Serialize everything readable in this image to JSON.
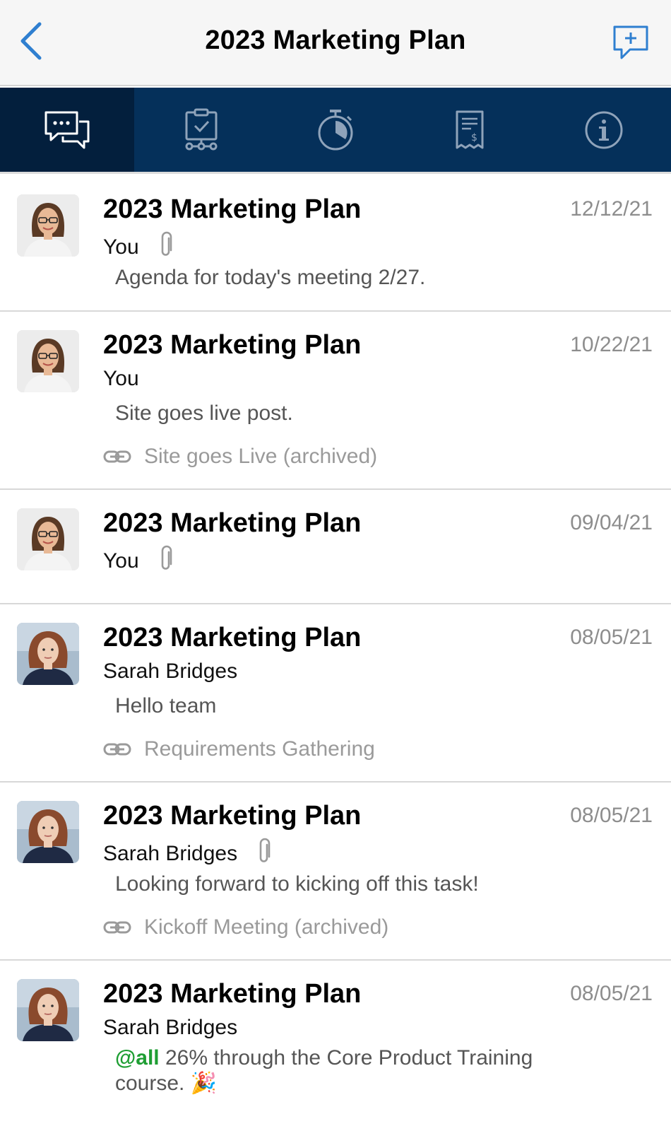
{
  "header": {
    "title": "2023 Marketing Plan",
    "back_icon": "chevron-left-icon",
    "new_comment_icon": "add-comment-icon",
    "accent_color": "#2f7fd0"
  },
  "tabs": [
    {
      "icon": "comments-icon",
      "active": true
    },
    {
      "icon": "task-board-icon",
      "active": false
    },
    {
      "icon": "timer-icon",
      "active": false
    },
    {
      "icon": "receipt-icon",
      "active": false
    },
    {
      "icon": "info-icon",
      "active": false
    }
  ],
  "tabbar_color": "#05305a",
  "messages": [
    {
      "title": "2023 Marketing Plan",
      "author": "You",
      "date": "12/12/21",
      "has_attachment": true,
      "message": "Agenda for today's meeting 2/27.",
      "link": null
    },
    {
      "title": "2023 Marketing Plan",
      "author": "You",
      "date": "10/22/21",
      "has_attachment": false,
      "message": "Site goes live post.",
      "link": "Site goes Live (archived)"
    },
    {
      "title": "2023 Marketing Plan",
      "author": "You",
      "date": "09/04/21",
      "has_attachment": true,
      "message": null,
      "link": null
    },
    {
      "title": "2023 Marketing Plan",
      "author": "Sarah Bridges",
      "date": "08/05/21",
      "has_attachment": false,
      "message": "Hello team",
      "link": "Requirements Gathering"
    },
    {
      "title": "2023 Marketing Plan",
      "author": "Sarah Bridges",
      "date": "08/05/21",
      "has_attachment": true,
      "message": "Looking forward to kicking off this task!",
      "link": "Kickoff Meeting (archived)"
    },
    {
      "title": "2023 Marketing Plan",
      "author": "Sarah Bridges",
      "date": "08/05/21",
      "has_attachment": false,
      "mention": "@all",
      "message": " 26% through the Core Product Training course. 🎉",
      "link": null
    }
  ]
}
